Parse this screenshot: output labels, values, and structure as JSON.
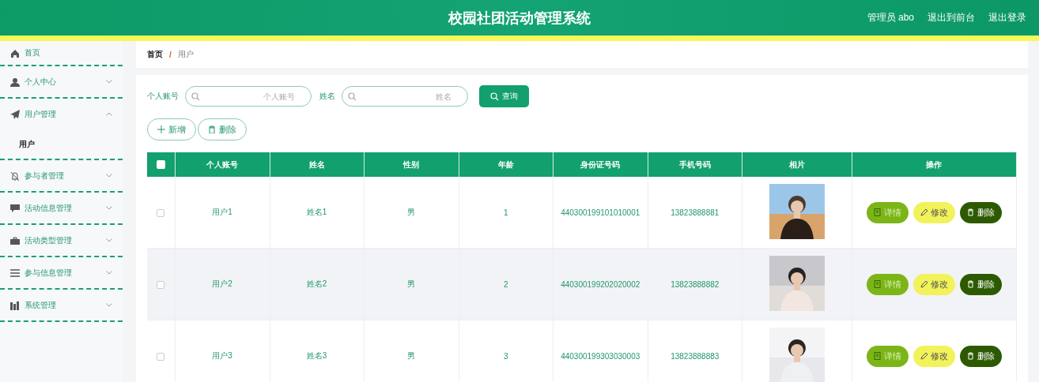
{
  "header": {
    "title": "校园社团活动管理系统",
    "user": "管理员 abo",
    "links": [
      "退出到前台",
      "退出登录"
    ]
  },
  "sidebar": {
    "items": [
      {
        "label": "首页",
        "kind": "link"
      },
      {
        "label": "个人中心",
        "kind": "submenu",
        "expanded": false
      },
      {
        "label": "用户管理",
        "kind": "submenu",
        "expanded": true,
        "children": [
          {
            "label": "用户",
            "selected": true
          }
        ]
      },
      {
        "label": "参与者管理",
        "kind": "submenu",
        "expanded": false
      },
      {
        "label": "活动信息管理",
        "kind": "submenu",
        "expanded": false
      },
      {
        "label": "活动类型管理",
        "kind": "submenu",
        "expanded": false
      },
      {
        "label": "参与信息管理",
        "kind": "submenu",
        "expanded": false
      },
      {
        "label": "系统管理",
        "kind": "submenu",
        "expanded": false
      }
    ]
  },
  "breadcrumb": {
    "items": [
      "首页",
      "用户"
    ],
    "separator": "/"
  },
  "search": {
    "fields": [
      {
        "label": "个人账号",
        "placeholder": "个人账号"
      },
      {
        "label": "姓名",
        "placeholder": "姓名"
      }
    ],
    "button": "查询"
  },
  "actions": [
    {
      "label": "新增",
      "kind": "add"
    },
    {
      "label": "删除",
      "kind": "delete"
    }
  ],
  "table": {
    "select_all_checked": false,
    "columns": [
      "个人账号",
      "姓名",
      "性别",
      "年龄",
      "身份证号码",
      "手机号码",
      "相片",
      "操作"
    ],
    "rows": [
      {
        "checked": false,
        "cells": [
          "用户1",
          "姓名1",
          "男",
          "1",
          "440300199101010001",
          "13823888881"
        ],
        "actions": [
          {
            "label": "详情",
            "kind": "detail"
          },
          {
            "label": "修改",
            "kind": "edit"
          },
          {
            "label": "删除",
            "kind": "delete"
          }
        ]
      },
      {
        "checked": false,
        "cells": [
          "用户2",
          "姓名2",
          "男",
          "2",
          "440300199202020002",
          "13823888882"
        ],
        "actions": [
          {
            "label": "详情",
            "kind": "detail"
          },
          {
            "label": "修改",
            "kind": "edit"
          },
          {
            "label": "删除",
            "kind": "delete"
          }
        ]
      },
      {
        "checked": false,
        "cells": [
          "用户3",
          "姓名3",
          "男",
          "3",
          "440300199303030003",
          "13823888883"
        ],
        "actions": [
          {
            "label": "详情",
            "kind": "detail"
          },
          {
            "label": "修改",
            "kind": "edit"
          },
          {
            "label": "删除",
            "kind": "delete"
          }
        ]
      }
    ]
  }
}
